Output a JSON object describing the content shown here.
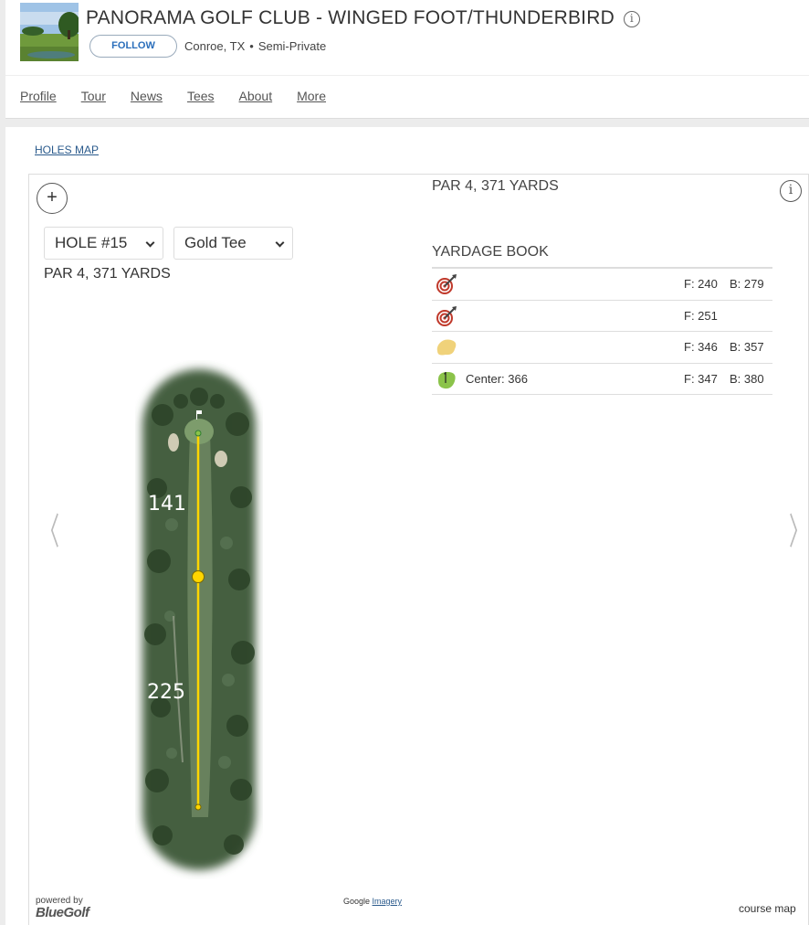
{
  "club": {
    "title": "PANORAMA GOLF CLUB - WINGED FOOT/THUNDERBIRD",
    "info_glyph": "i",
    "follow_label": "FOLLOW",
    "location": "Conroe, TX",
    "dot": "•",
    "type": "Semi-Private"
  },
  "nav": {
    "items": [
      "Profile",
      "Tour",
      "News",
      "Tees",
      "About",
      "More"
    ]
  },
  "holes_map_link": "HOLES MAP",
  "hole": {
    "zoom_glyph": "+",
    "hole_select": "HOLE #15",
    "tee_select": "Gold Tee",
    "par_yards": "PAR 4, 371 YARDS",
    "prev_arrow": "〈",
    "next_arrow": "〉",
    "map_labels": {
      "upper": "141",
      "lower": "225"
    }
  },
  "yardage_book": {
    "header": "PAR 4, 371 YARDS",
    "title": "YARDAGE BOOK",
    "info_glyph": "i",
    "rows": [
      {
        "icon": "target-icon",
        "label": "",
        "front": "F: 240",
        "back": "B: 279"
      },
      {
        "icon": "target-icon",
        "label": "",
        "front": "F: 251",
        "back": ""
      },
      {
        "icon": "bunker-icon",
        "label": "",
        "front": "F: 346",
        "back": "B: 357"
      },
      {
        "icon": "green-flag-icon",
        "label": "Center: 366",
        "front": "F: 347",
        "back": "B: 380"
      }
    ]
  },
  "footer": {
    "powered_by": "powered by",
    "brand": "BlueGolf",
    "google": "Google",
    "imagery": "Imagery",
    "course_map": "course map"
  },
  "colors": {
    "accent_link": "#2a5a8c",
    "follow_text": "#2a6ebb",
    "target_red": "#c0392b",
    "bunker": "#f0d27a",
    "green": "#8bc34a",
    "shot_line": "#ffd600"
  }
}
